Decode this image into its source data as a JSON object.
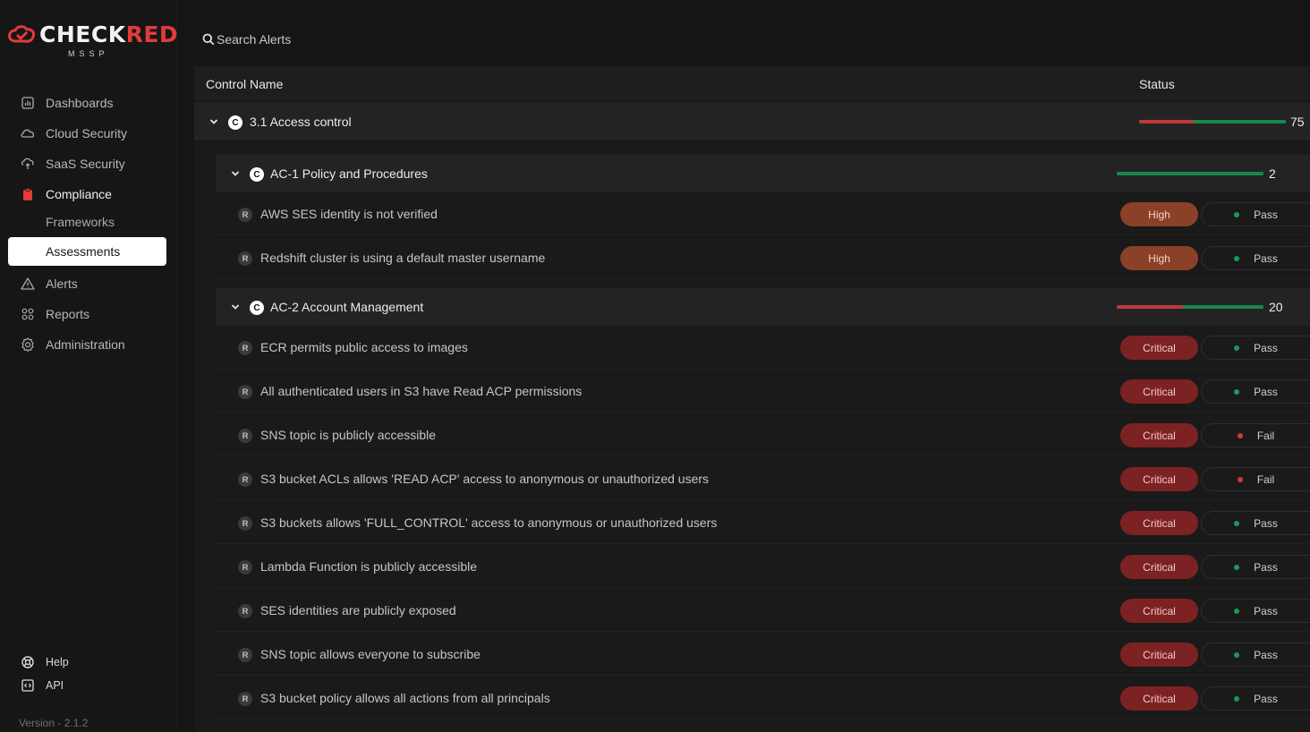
{
  "brand": {
    "name_a": "CHECK",
    "name_b": "RED",
    "sub": "MSSP",
    "accent": "#e23b3b"
  },
  "nav": {
    "items": [
      {
        "label": "Dashboards",
        "icon": "dashboard-icon"
      },
      {
        "label": "Cloud Security",
        "icon": "cloud-icon"
      },
      {
        "label": "SaaS Security",
        "icon": "saas-icon"
      },
      {
        "label": "Compliance",
        "icon": "clipboard-icon"
      },
      {
        "label": "Alerts",
        "icon": "warning-icon"
      },
      {
        "label": "Reports",
        "icon": "grid-icon"
      },
      {
        "label": "Administration",
        "icon": "settings-icon"
      }
    ],
    "subitems": [
      "Frameworks",
      "Assessments"
    ],
    "active": "Assessments"
  },
  "bottom": {
    "help": "Help",
    "api": "API",
    "version": "Version - 2.1.2"
  },
  "search": {
    "placeholder": "Search Alerts"
  },
  "table": {
    "col_control": "Control Name",
    "col_status": "Status",
    "root": {
      "badge": "C",
      "title": "3.1 Access control",
      "count": "75",
      "fail_fraction": 0.37
    },
    "groups": [
      {
        "badge": "C",
        "title": "AC-1 Policy and Procedures",
        "count": "2",
        "fail_fraction": 0,
        "rules": [
          {
            "badge": "R",
            "title": "AWS SES identity is not verified",
            "severity": "High",
            "status": "Pass"
          },
          {
            "badge": "R",
            "title": "Redshift cluster is using a default master username",
            "severity": "High",
            "status": "Pass"
          }
        ]
      },
      {
        "badge": "C",
        "title": "AC-2 Account Management",
        "count": "20",
        "fail_fraction": 0.45,
        "rules": [
          {
            "badge": "R",
            "title": "ECR permits public access to images",
            "severity": "Critical",
            "status": "Pass"
          },
          {
            "badge": "R",
            "title": "All authenticated users in S3 have Read ACP permissions",
            "severity": "Critical",
            "status": "Pass"
          },
          {
            "badge": "R",
            "title": "SNS topic is publicly accessible",
            "severity": "Critical",
            "status": "Fail"
          },
          {
            "badge": "R",
            "title": "S3 bucket ACLs allows 'READ ACP' access to anonymous or unauthorized users",
            "severity": "Critical",
            "status": "Fail"
          },
          {
            "badge": "R",
            "title": "S3 buckets allows 'FULL_CONTROL' access to anonymous or unauthorized users",
            "severity": "Critical",
            "status": "Pass"
          },
          {
            "badge": "R",
            "title": "Lambda Function is publicly accessible",
            "severity": "Critical",
            "status": "Pass"
          },
          {
            "badge": "R",
            "title": "SES identities are publicly exposed",
            "severity": "Critical",
            "status": "Pass"
          },
          {
            "badge": "R",
            "title": "SNS topic allows everyone to subscribe",
            "severity": "Critical",
            "status": "Pass"
          },
          {
            "badge": "R",
            "title": "S3 bucket policy allows all actions from all principals",
            "severity": "Critical",
            "status": "Pass"
          }
        ]
      }
    ]
  }
}
